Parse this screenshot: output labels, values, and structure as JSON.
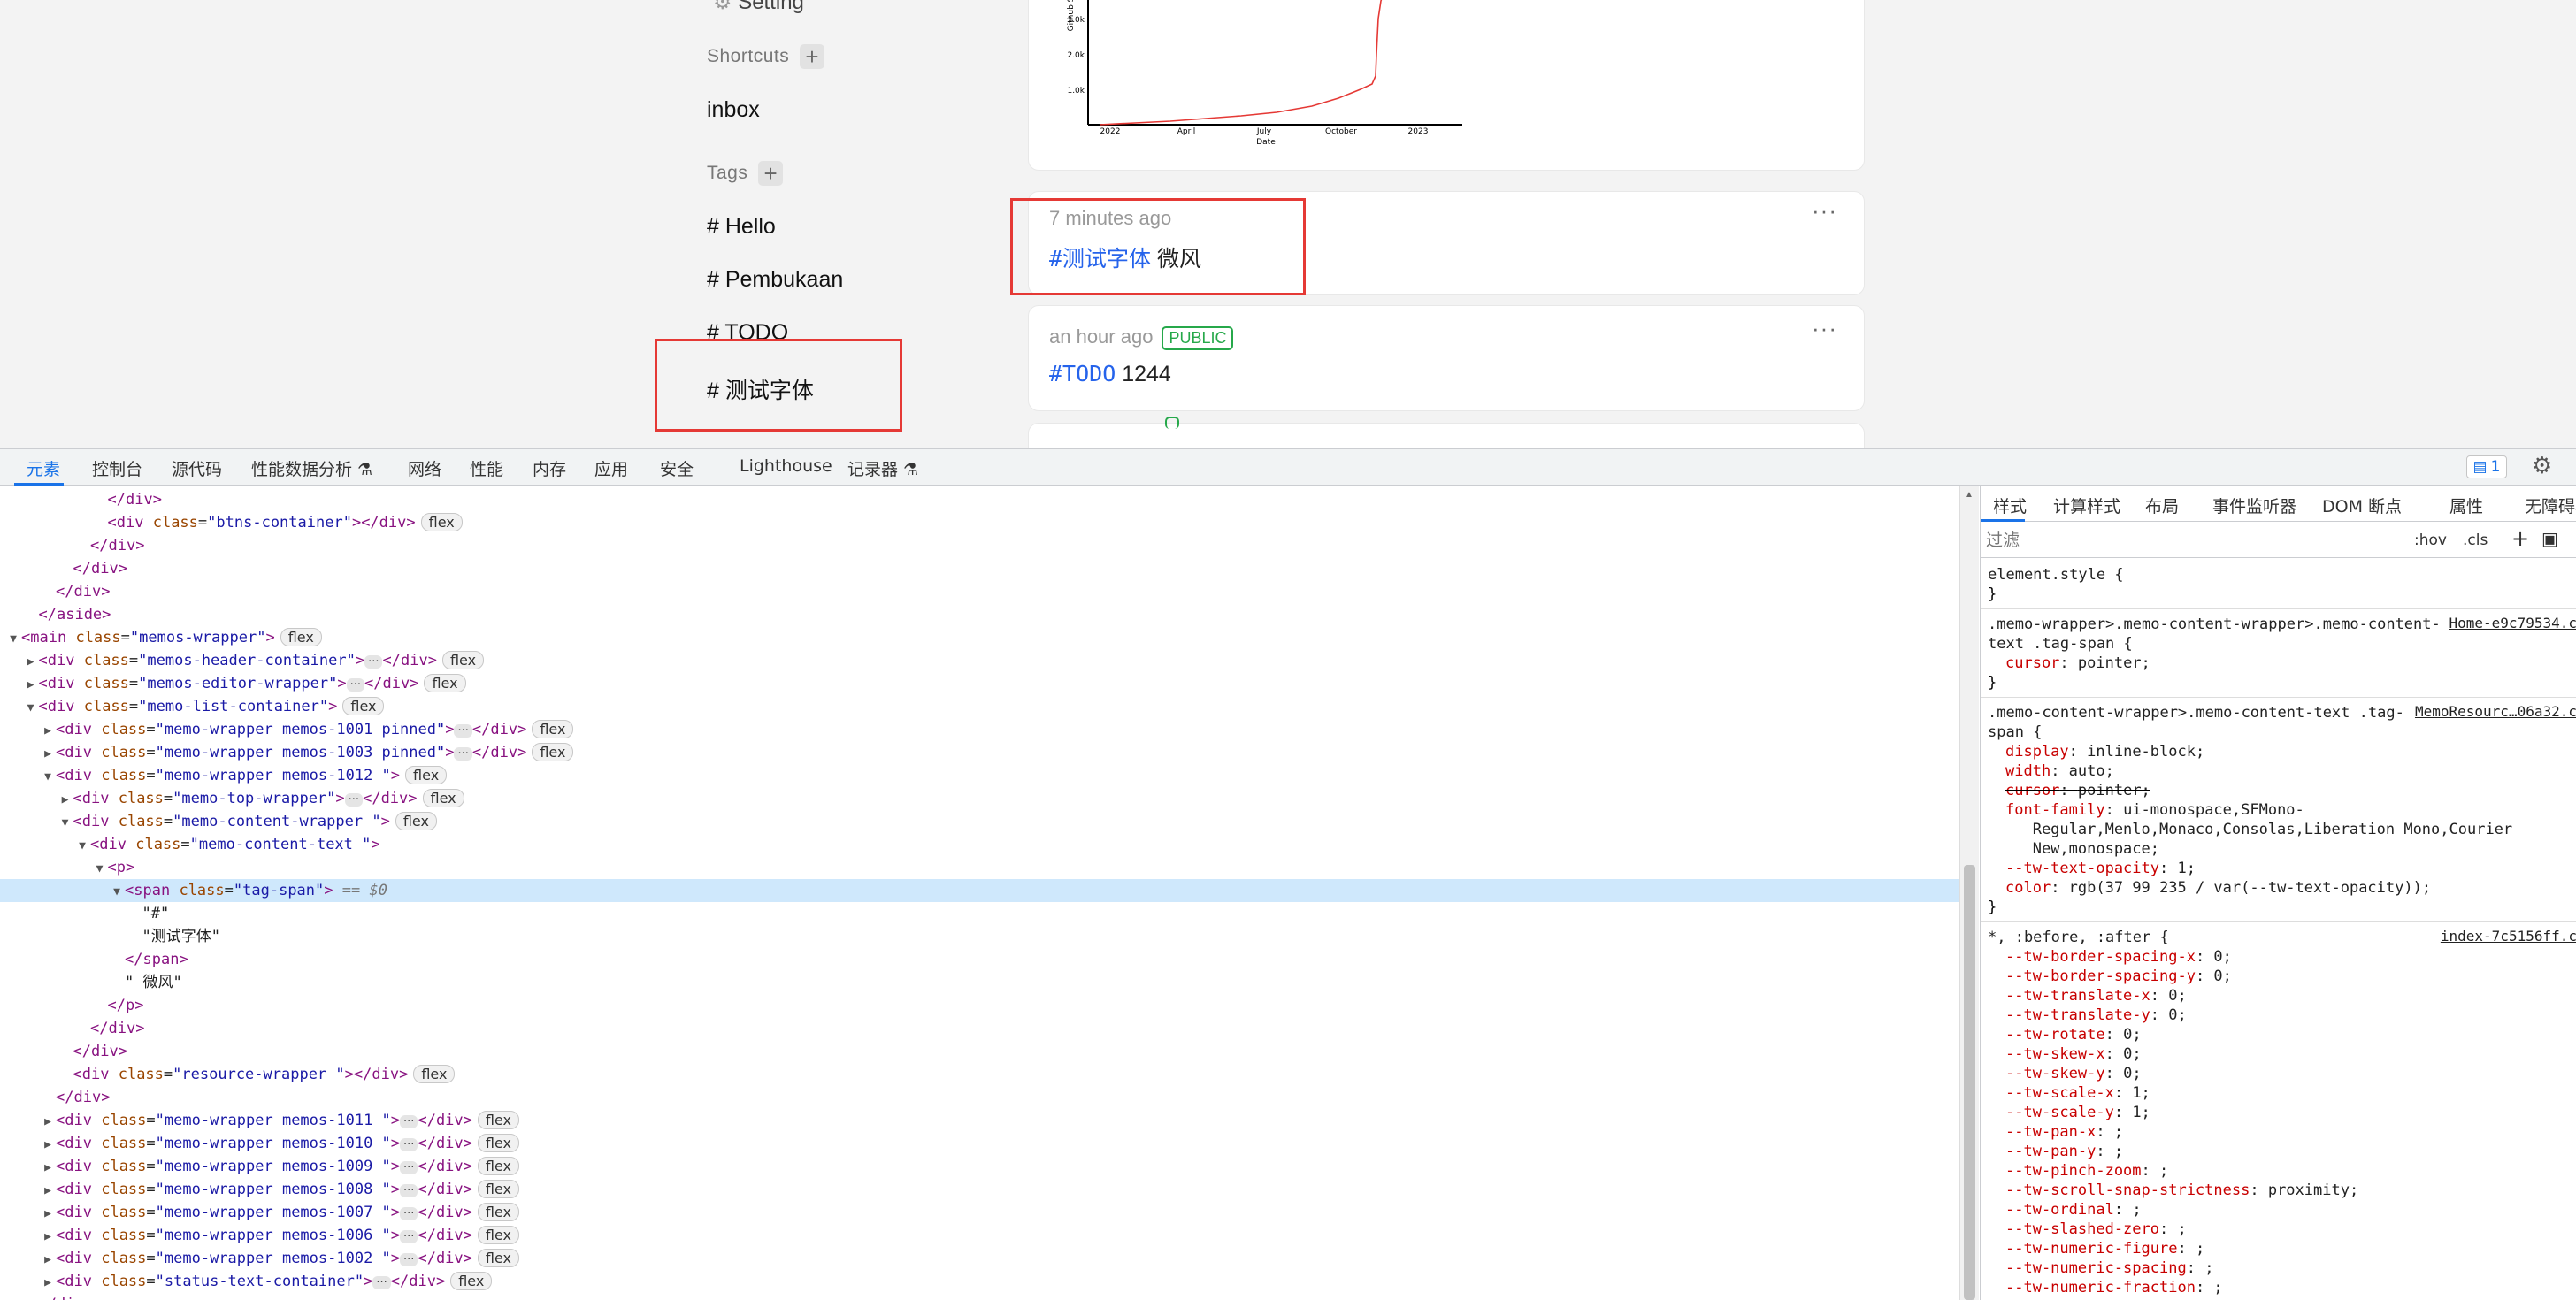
{
  "app": {
    "sidebar": {
      "setting_label": "Setting",
      "shortcuts_title": "Shortcuts",
      "shortcut_items": [
        "inbox"
      ],
      "tags_title": "Tags",
      "tag_items": [
        "# Hello",
        "# Pembukaan",
        "# TODO",
        "# 测试字体"
      ]
    },
    "chart": {
      "y_ticks": [
        "3.0k",
        "2.0k",
        "1.0k"
      ],
      "x_ticks": [
        "2022",
        "April",
        "July",
        "October",
        "2023"
      ],
      "xlabel": "Date",
      "ylabel": "Github S"
    },
    "memos": [
      {
        "time": "7 minutes ago",
        "tag": "#测试字体",
        "text": " 微风",
        "badge": ""
      },
      {
        "time": "an hour ago",
        "tag": "#TODO",
        "text": " 1244",
        "badge": "PUBLIC"
      }
    ],
    "more_icon": "···"
  },
  "devtools": {
    "tabs": [
      "元素",
      "控制台",
      "源代码",
      "性能数据分析 ⚗",
      "网络",
      "性能",
      "内存",
      "应用",
      "安全",
      "Lighthouse",
      "记录器 ⚗"
    ],
    "issue_count": "1",
    "styles_tabs": [
      "样式",
      "计算样式",
      "布局",
      "事件监听器",
      "DOM 断点",
      "属性",
      "无障碍功能"
    ],
    "filter_placeholder": "过滤",
    "hov": ":hov",
    "cls": ".cls",
    "dom_lines": [
      {
        "i": 5,
        "t": "close",
        "tag": "div"
      },
      {
        "i": 5,
        "t": "pair",
        "tag": "div",
        "cls": "btns-container",
        "pill": "flex"
      },
      {
        "i": 4,
        "t": "close",
        "tag": "div"
      },
      {
        "i": 3,
        "t": "close",
        "tag": "div"
      },
      {
        "i": 2,
        "t": "close",
        "tag": "div"
      },
      {
        "i": 1,
        "t": "close",
        "tag": "aside"
      },
      {
        "i": 0,
        "t": "open",
        "tri": "▼",
        "tag": "main",
        "cls": "memos-wrapper",
        "pill": "flex"
      },
      {
        "i": 1,
        "t": "col",
        "tri": "▶",
        "tag": "div",
        "cls": "memos-header-container",
        "pill": "flex"
      },
      {
        "i": 1,
        "t": "col",
        "tri": "▶",
        "tag": "div",
        "cls": "memos-editor-wrapper",
        "pill": "flex"
      },
      {
        "i": 1,
        "t": "open",
        "tri": "▼",
        "tag": "div",
        "cls": "memo-list-container",
        "pill": "flex"
      },
      {
        "i": 2,
        "t": "col",
        "tri": "▶",
        "tag": "div",
        "cls": "memo-wrapper memos-1001 pinned",
        "pill": "flex"
      },
      {
        "i": 2,
        "t": "col",
        "tri": "▶",
        "tag": "div",
        "cls": "memo-wrapper memos-1003 pinned",
        "pill": "flex"
      },
      {
        "i": 2,
        "t": "open",
        "tri": "▼",
        "tag": "div",
        "cls": "memo-wrapper memos-1012 ",
        "pill": "flex"
      },
      {
        "i": 3,
        "t": "col",
        "tri": "▶",
        "tag": "div",
        "cls": "memo-top-wrapper",
        "pill": "flex"
      },
      {
        "i": 3,
        "t": "open",
        "tri": "▼",
        "tag": "div",
        "cls": "memo-content-wrapper ",
        "pill": "flex"
      },
      {
        "i": 4,
        "t": "open",
        "tri": "▼",
        "tag": "div",
        "cls": "memo-content-text "
      },
      {
        "i": 5,
        "t": "open",
        "tri": "▼",
        "tag": "p"
      },
      {
        "i": 6,
        "t": "open",
        "tri": "▼",
        "tag": "span",
        "cls": "tag-span",
        "sel": true,
        "eq": "== $0"
      },
      {
        "i": 7,
        "t": "text",
        "text": "\"#\""
      },
      {
        "i": 7,
        "t": "text",
        "text": "\"测试字体\""
      },
      {
        "i": 6,
        "t": "close",
        "tag": "span"
      },
      {
        "i": 6,
        "t": "text",
        "text": "\" 微风\""
      },
      {
        "i": 5,
        "t": "close",
        "tag": "p"
      },
      {
        "i": 4,
        "t": "close",
        "tag": "div"
      },
      {
        "i": 3,
        "t": "close",
        "tag": "div"
      },
      {
        "i": 3,
        "t": "pair",
        "tag": "div",
        "cls": "resource-wrapper ",
        "pill": "flex"
      },
      {
        "i": 2,
        "t": "close",
        "tag": "div"
      },
      {
        "i": 2,
        "t": "col",
        "tri": "▶",
        "tag": "div",
        "cls": "memo-wrapper memos-1011 ",
        "pill": "flex"
      },
      {
        "i": 2,
        "t": "col",
        "tri": "▶",
        "tag": "div",
        "cls": "memo-wrapper memos-1010 ",
        "pill": "flex"
      },
      {
        "i": 2,
        "t": "col",
        "tri": "▶",
        "tag": "div",
        "cls": "memo-wrapper memos-1009 ",
        "pill": "flex"
      },
      {
        "i": 2,
        "t": "col",
        "tri": "▶",
        "tag": "div",
        "cls": "memo-wrapper memos-1008 ",
        "pill": "flex"
      },
      {
        "i": 2,
        "t": "col",
        "tri": "▶",
        "tag": "div",
        "cls": "memo-wrapper memos-1007 ",
        "pill": "flex"
      },
      {
        "i": 2,
        "t": "col",
        "tri": "▶",
        "tag": "div",
        "cls": "memo-wrapper memos-1006 ",
        "pill": "flex"
      },
      {
        "i": 2,
        "t": "col",
        "tri": "▶",
        "tag": "div",
        "cls": "memo-wrapper memos-1002 ",
        "pill": "flex"
      },
      {
        "i": 2,
        "t": "col",
        "tri": "▶",
        "tag": "div",
        "cls": "status-text-container",
        "pill": "flex"
      },
      {
        "i": 1,
        "t": "close",
        "tag": "div"
      }
    ],
    "css_rules": [
      {
        "sel": [
          "element.style {"
        ],
        "src": "",
        "props": []
      },
      {
        "sel": [
          ".memo-wrapper>.memo-content-wrapper>.memo-content-",
          "text .tag-span {"
        ],
        "src": "Home-e9c79534.c",
        "props": [
          {
            "n": "cursor",
            "v": "pointer;"
          }
        ]
      },
      {
        "sel": [
          ".memo-content-wrapper>.memo-content-text .tag-",
          "span {"
        ],
        "src": "MemoResourc…06a32.c",
        "props": [
          {
            "n": "display",
            "v": "inline-block;"
          },
          {
            "n": "width",
            "v": "auto;"
          },
          {
            "n": "cursor",
            "v": "pointer;",
            "strike": true
          },
          {
            "n": "font-family",
            "v": "ui-monospace,SFMono-"
          },
          {
            "n": "",
            "v": "   Regular,Menlo,Monaco,Consolas,Liberation Mono,Courier"
          },
          {
            "n": "",
            "v": "   New,monospace;"
          },
          {
            "n": "--tw-text-opacity",
            "v": "1;"
          },
          {
            "n": "color",
            "v": "rgb(37 99 235 / var(--tw-text-opacity));"
          }
        ]
      },
      {
        "sel": [
          "*, :before, :after {"
        ],
        "src": "index-7c5156ff.c",
        "props": [
          {
            "n": "--tw-border-spacing-x",
            "v": "0;"
          },
          {
            "n": "--tw-border-spacing-y",
            "v": "0;"
          },
          {
            "n": "--tw-translate-x",
            "v": "0;"
          },
          {
            "n": "--tw-translate-y",
            "v": "0;"
          },
          {
            "n": "--tw-rotate",
            "v": "0;"
          },
          {
            "n": "--tw-skew-x",
            "v": "0;"
          },
          {
            "n": "--tw-skew-y",
            "v": "0;"
          },
          {
            "n": "--tw-scale-x",
            "v": "1;"
          },
          {
            "n": "--tw-scale-y",
            "v": "1;"
          },
          {
            "n": "--tw-pan-x",
            "v": ";"
          },
          {
            "n": "--tw-pan-y",
            "v": ";"
          },
          {
            "n": "--tw-pinch-zoom",
            "v": ";"
          },
          {
            "n": "--tw-scroll-snap-strictness",
            "v": "proximity;"
          },
          {
            "n": "--tw-ordinal",
            "v": ";"
          },
          {
            "n": "--tw-slashed-zero",
            "v": ";"
          },
          {
            "n": "--tw-numeric-figure",
            "v": ";"
          },
          {
            "n": "--tw-numeric-spacing",
            "v": ";"
          },
          {
            "n": "--tw-numeric-fraction",
            "v": ";"
          }
        ]
      }
    ]
  }
}
